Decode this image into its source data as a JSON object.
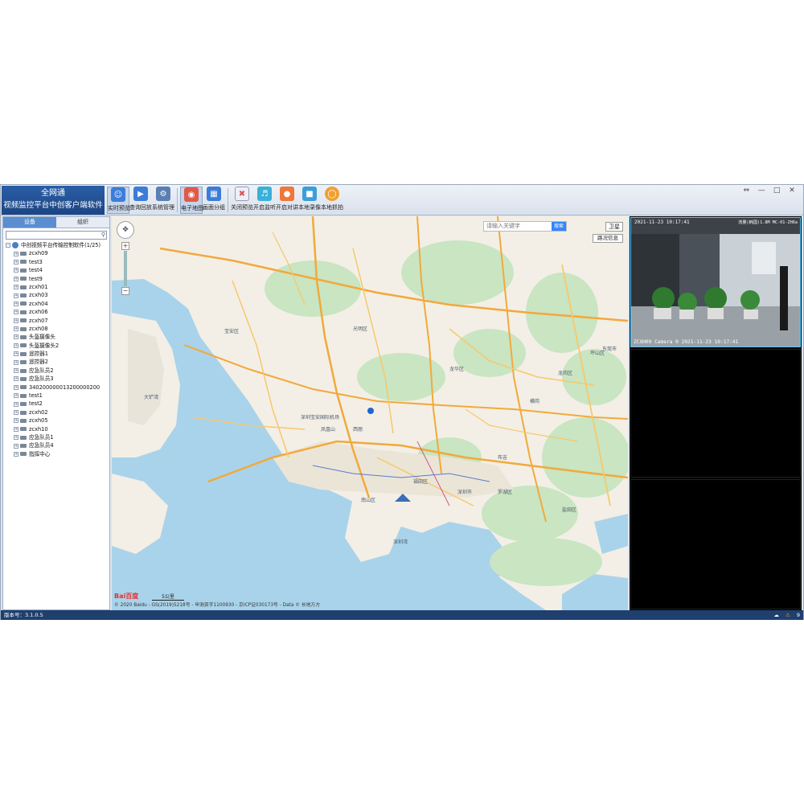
{
  "app": {
    "logo_line1": "全网通",
    "logo_line2": "视频监控平台中创客户端软件"
  },
  "toolbar": {
    "buttons": [
      {
        "label": "实时预览",
        "color": "#3b7dd8",
        "active": true
      },
      {
        "label": "查询回放",
        "color": "#3b7dd8"
      },
      {
        "label": "系统管理",
        "color": "#5b7fb3"
      },
      {
        "label": "电子地图",
        "color": "#e05a4a",
        "active": true
      },
      {
        "label": "画面分组",
        "color": "#3b7dd8"
      },
      {
        "label": "关闭预览",
        "color": "#d9534f"
      },
      {
        "label": "开启监听",
        "color": "#3ab0d8"
      },
      {
        "label": "开启对讲",
        "color": "#f0763a"
      },
      {
        "label": "本地录像",
        "color": "#3b9fd8"
      },
      {
        "label": "本地抓拍",
        "color": "#f0a030"
      }
    ]
  },
  "window_controls": {
    "pin": "⇔",
    "minimize": "—",
    "maximize": "□",
    "close": "✕"
  },
  "left_panel": {
    "tabs": [
      {
        "label": "设备",
        "active": true
      },
      {
        "label": "组织"
      }
    ],
    "search_icon": "magnifier-icon",
    "root": "中创视频平台传输控制软件(1/25)",
    "devices": [
      "zcxh09",
      "test3",
      "test4",
      "test9",
      "zcxh01",
      "zcxh03",
      "zcxh04",
      "zcxh06",
      "zcxh07",
      "zcxh08",
      "头盔摄像头",
      "头盔摄像头2",
      "遥控器1",
      "遥控器2",
      "应急队员2",
      "应急队员3",
      "340200000013200000200",
      "test1",
      "test2",
      "zcxh02",
      "zcxh05",
      "zcxh10",
      "应急队员1",
      "应急队员4",
      "指挥中心"
    ]
  },
  "map": {
    "search_placeholder": "请输入关键字",
    "search_button": "搜索",
    "satellite_button": "卫星",
    "road_info_button": "路况信息",
    "zoom_in": "+",
    "zoom_out": "−",
    "nav": "✥",
    "baidu_logo": "Bai百度",
    "scale": "5公里",
    "copyright": "© 2020 Baidu - GS(2019)5218号 - 甲测资字1100930 - 京ICP证030173号 - Data © 长地万方",
    "labels": [
      "宝安区",
      "光明区",
      "龙华区",
      "南山区",
      "深圳市",
      "罗湖区",
      "福田区",
      "龙岗区",
      "坪山区",
      "盐田区",
      "东莞市",
      "凤凰山",
      "大铲湾",
      "深圳宝安国际机场",
      "西丽",
      "布吉",
      "横岗",
      "深圳湾"
    ],
    "colors": {
      "water": "#a9d3ea",
      "land": "#f3efe6",
      "green": "#c9e5c2",
      "road": "#f7c86b",
      "highway": "#f2a93b"
    }
  },
  "video": {
    "cell1_top_left": "2021-11-23 10:17:41",
    "cell1_top_right": "流量(韩国)1.8M    MC-01-ZH6a",
    "cell1_bottom": "ZCXH09 Camera 0 2021-11-23 10:17:41"
  },
  "status": {
    "version": "版本号：3.1.0.5",
    "alarm_count": "9"
  }
}
